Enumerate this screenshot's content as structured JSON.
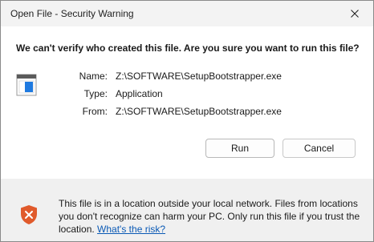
{
  "window": {
    "title": "Open File - Security Warning"
  },
  "dialog": {
    "question": "We can't verify who created this file. Are you sure you want to run this file?",
    "properties": [
      {
        "label": "Name:",
        "value": "Z:\\SOFTWARE\\SetupBootstrapper.exe"
      },
      {
        "label": "Type:",
        "value": "Application"
      },
      {
        "label": "From:",
        "value": "Z:\\SOFTWARE\\SetupBootstrapper.exe"
      }
    ],
    "run_label": "Run",
    "cancel_label": "Cancel"
  },
  "warning": {
    "text": "This file is in a location outside your local network. Files from locations you don't recognize can harm your PC. Only run this file if you trust the location.",
    "link_text": "What's the risk?"
  },
  "icons": {
    "close": "close-icon",
    "file": "application-file-icon",
    "shield": "shield-warning-icon"
  },
  "colors": {
    "link": "#0a59b5",
    "shield": "#e05a2b"
  }
}
